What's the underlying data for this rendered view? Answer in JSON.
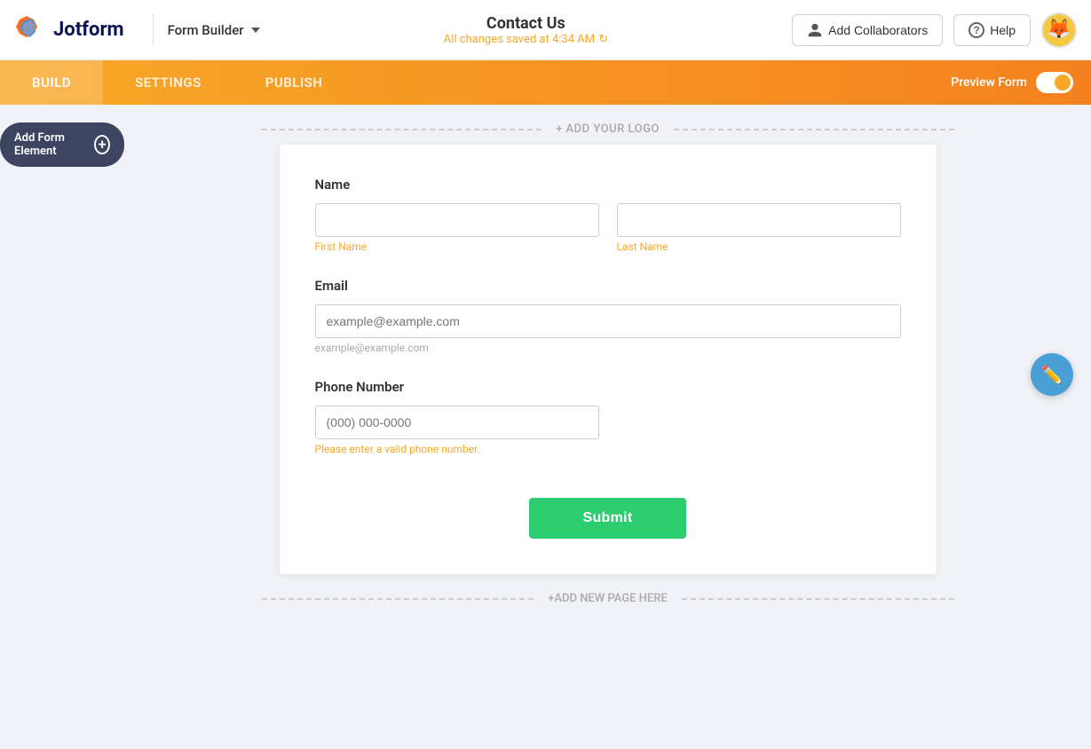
{
  "header": {
    "logo_text": "Jotform",
    "form_builder_label": "Form Builder",
    "form_title": "Contact Us",
    "saved_status": "All changes saved at 4:34 AM",
    "add_collaborators_label": "Add Collaborators",
    "help_label": "Help",
    "avatar_emoji": "🦊"
  },
  "tabs": {
    "build_label": "BUILD",
    "settings_label": "SETTINGS",
    "publish_label": "PUBLISH",
    "preview_label": "Preview Form"
  },
  "sidebar": {
    "add_element_label": "Add Form Element",
    "add_icon": "+"
  },
  "canvas": {
    "add_logo_text": "+ ADD YOUR LOGO",
    "add_page_text": "+ADD NEW PAGE HERE"
  },
  "form": {
    "name_label": "Name",
    "first_name_label": "First Name",
    "last_name_label": "Last Name",
    "email_label": "Email",
    "email_placeholder": "example@example.com",
    "phone_label": "Phone Number",
    "phone_placeholder": "(000) 000-0000",
    "phone_error": "Please enter a valid phone number.",
    "submit_label": "Submit"
  },
  "colors": {
    "orange": "#f7a827",
    "orange_dark": "#f58220",
    "green": "#2ecc71",
    "blue": "#4a9fd4",
    "dark_sidebar": "#3d4460"
  }
}
